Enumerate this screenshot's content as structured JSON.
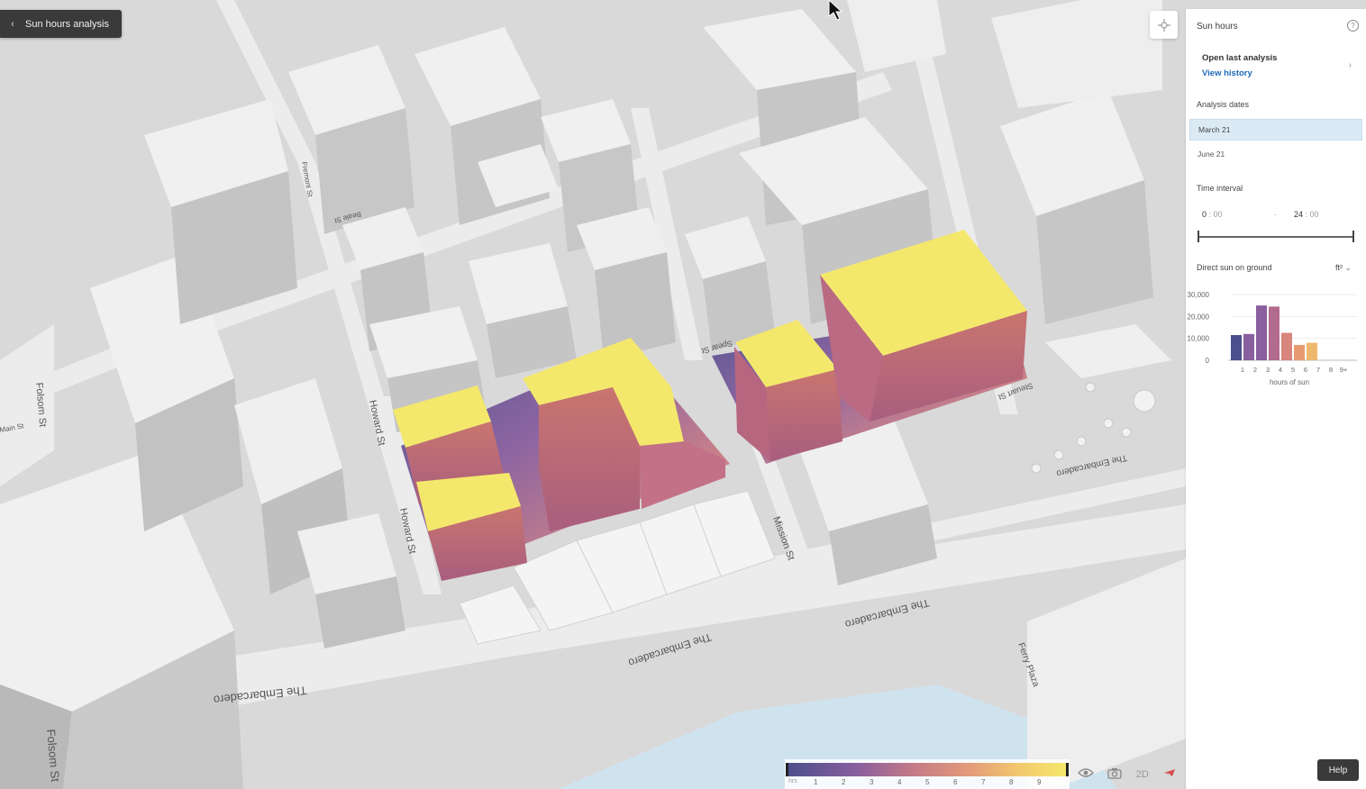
{
  "header": {
    "back_label": "Sun hours analysis",
    "back_icon": "chevron-left-icon"
  },
  "map": {
    "street_labels": [
      "Howard St",
      "Howard St",
      "Mission St",
      "Folsom St",
      "Folsom St",
      "The Embarcadero",
      "The Embarcadero",
      "The Embarcadero",
      "The Embarcadero",
      "Ferry Plaza",
      "Spear St",
      "Steuart St",
      "Beale St",
      "Fremont St",
      "Main St"
    ],
    "colors": {
      "ground": "#d9d9d9",
      "building_roof": "#f1f1f1",
      "building_side": "#bdbdbd",
      "water": "#cfe3ef",
      "sun_high": "#f4e86c",
      "sun_low": "#4b4f8c"
    }
  },
  "panel": {
    "title": "Sun hours",
    "help_icon": "question-icon",
    "last_analysis": {
      "heading": "Open last analysis",
      "link": "View history"
    },
    "analysis_dates_label": "Analysis dates",
    "dates": [
      "March 21",
      "June 21"
    ],
    "selected_date": "March 21",
    "time_interval_label": "Time interval",
    "time_start": {
      "h": "0",
      "m": ": 00"
    },
    "time_sep": "-",
    "time_end": {
      "h": "24",
      "m": ": 00"
    },
    "direct_sun_label": "Direct sun on ground",
    "unit_label": "ft²"
  },
  "chart_data": {
    "type": "bar",
    "title": "Direct sun on ground",
    "xlabel": "hours of sun",
    "ylabel": "",
    "categories": [
      "1",
      "2",
      "3",
      "4",
      "5",
      "6",
      "7",
      "8",
      "9+"
    ],
    "yticks": [
      "30,000",
      "20,000",
      "10,000",
      "0"
    ],
    "ylim": [
      0,
      30000
    ],
    "values": [
      12000,
      25000,
      24500,
      12500,
      7000,
      8000,
      0,
      0,
      0
    ],
    "prefix_bar": 11500,
    "colors": [
      "#4b4f8c",
      "#8a5f9e",
      "#8a5f9e",
      "#b36a8f",
      "#d8857d",
      "#e79b73",
      "#eeb86f",
      "#f2d36d",
      "#f4e86c"
    ]
  },
  "legend": {
    "ticks": [
      "hrs",
      "1",
      "2",
      "3",
      "4",
      "5",
      "6",
      "7",
      "8",
      "9"
    ]
  },
  "tools": {
    "view_icon": "eye-icon",
    "camera_icon": "camera-icon",
    "mode": "2D",
    "compass_icon": "compass-icon"
  },
  "help_label": "Help"
}
